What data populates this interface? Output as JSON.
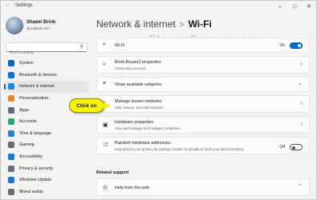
{
  "window": {
    "title": "Settings"
  },
  "user": {
    "name": "Shawn Brink",
    "email": "@outlook.com"
  },
  "search": {
    "placeholder": "Find a setting"
  },
  "nav": [
    {
      "label": "System",
      "icon": "monitor-icon",
      "color": "#0067c0"
    },
    {
      "label": "Bluetooth & devices",
      "icon": "bluetooth-icon",
      "color": "#0a6fd8"
    },
    {
      "label": "Network & internet",
      "icon": "wifi-icon",
      "color": "#1f86e0",
      "active": true
    },
    {
      "label": "Personalization",
      "icon": "brush-icon",
      "color": "#e08a2c"
    },
    {
      "label": "Apps",
      "icon": "apps-icon",
      "color": "#5b6b84"
    },
    {
      "label": "Accounts",
      "icon": "person-icon",
      "color": "#2aa46c"
    },
    {
      "label": "Time & language",
      "icon": "globe-clock-icon",
      "color": "#2f7fd1"
    },
    {
      "label": "Gaming",
      "icon": "gamepad-icon",
      "color": "#6a6a6a"
    },
    {
      "label": "Accessibility",
      "icon": "accessibility-icon",
      "color": "#1c76c9"
    },
    {
      "label": "Privacy & security",
      "icon": "shield-icon",
      "color": "#6b6f78"
    },
    {
      "label": "Windows Update",
      "icon": "update-icon",
      "color": "#1a78d0"
    },
    {
      "label": "Mixed reality",
      "icon": "headset-icon",
      "color": "#6a6a6a"
    }
  ],
  "breadcrumb": {
    "parent": "Network & internet",
    "separator": ">",
    "current": "Wi-Fi"
  },
  "watermark": "ElevenForum.com",
  "wifi_card": {
    "title": "Wi-Fi",
    "state": "On"
  },
  "network_card": {
    "title": "Brink-Router2 properties",
    "subtitle": "Connected, secured"
  },
  "available_card": {
    "title": "Show available networks"
  },
  "known_card": {
    "title": "Manage known networks",
    "subtitle": "Add, remove, and edit networks"
  },
  "hardware_card": {
    "title": "Hardware properties",
    "subtitle": "View and manage Wi-Fi adapter properties"
  },
  "random_card": {
    "title": "Random hardware addresses",
    "subtitle": "Help protect your privacy by making it harder for people to track your device location.",
    "state": "Off"
  },
  "related": {
    "heading": "Related support",
    "help_title": "Help from the web"
  },
  "callout": {
    "label": "Click on",
    "color": "#f4f20a"
  },
  "colors": {
    "accent": "#0067c0"
  }
}
